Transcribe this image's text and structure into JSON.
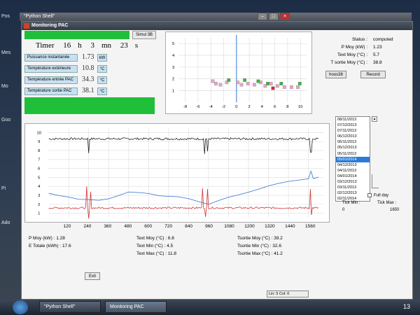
{
  "desktop": {
    "icons": [
      "Pos",
      "Mes",
      "Mo",
      "Goo",
      "Pi",
      "Ado"
    ],
    "shell_title": "\"Python Shell\""
  },
  "window": {
    "title": "Monitoring PAC",
    "simul_button": "Simul 3B"
  },
  "timer": {
    "label": "Timer",
    "h": "16",
    "h_unit": "h",
    "mn": "3",
    "mn_unit": "mn",
    "s": "23",
    "s_unit": "s"
  },
  "measurements": [
    {
      "label": "Puissance instantanée",
      "value": "1.73",
      "unit": "kW"
    },
    {
      "label": "Température extérieure",
      "value": "10.8",
      "unit": "°C"
    },
    {
      "label": "Température entrée PAC",
      "value": "34.3",
      "unit": "°C"
    },
    {
      "label": "Température sortie PAC",
      "value": "38.1",
      "unit": "°C"
    }
  ],
  "status": {
    "rows": [
      {
        "key": "Status :",
        "value": "computed"
      },
      {
        "key": "P Moy (kW) :",
        "value": "1.23"
      },
      {
        "key": "Text Moy (°C) :",
        "value": "5.7"
      },
      {
        "key": "T sortie Moy (°C) :",
        "value": "38.8"
      }
    ],
    "button_1": "hoos38",
    "button_2": "Record"
  },
  "date_list": {
    "items": [
      "08/11/2013",
      "07/12/2013",
      "07/11/2013",
      "06/12/2013",
      "06/11/2013",
      "05/12/2013",
      "05/11/2013",
      "05/01/2014",
      "04/12/2013",
      "04/11/2013",
      "04/01/2014",
      "03/12/2013",
      "03/11/2013",
      "02/12/2013",
      "02/11/2014"
    ],
    "selected_index": 7
  },
  "controls": {
    "full_day": "Full day",
    "tick_min_label": "Tick Min :",
    "tick_max_label": "Tick Max :",
    "tick_min_value": "0",
    "tick_max_value": "1650"
  },
  "stats": {
    "col1": [
      {
        "k": "P Moy (kW) :",
        "v": "1.28"
      },
      {
        "k": "E Totale (kWh) :",
        "v": "17.6"
      }
    ],
    "col2": [
      {
        "k": "Text Moy (°C) :",
        "v": "6.8"
      },
      {
        "k": "Text Min (°C) :",
        "v": "4.5"
      },
      {
        "k": "Text Max (°C) :",
        "v": "11.8"
      }
    ],
    "col3": [
      {
        "k": "Tsortie Moy (°C) :",
        "v": "39.2"
      },
      {
        "k": "Tsortie Min (°C) :",
        "v": "32.6"
      },
      {
        "k": "Tsortie Max (°C) :",
        "v": "41.2"
      }
    ]
  },
  "exit_label": "Exit",
  "statusbar_text": "Lin: 5 Col: 0",
  "taskbar": {
    "tasks": [
      "\"Python Shell\"",
      "Monitoring PAC"
    ],
    "clock": "13"
  },
  "chart_data": [
    {
      "type": "scatter",
      "x_ticks": [
        "-8",
        "-6",
        "-4",
        "-2",
        "0",
        "2",
        "4",
        "6",
        "8",
        "10"
      ],
      "y_ticks": [
        "1",
        "2",
        "3",
        "4",
        "5"
      ],
      "xlim": [
        -9,
        11
      ],
      "ylim": [
        0,
        5.5
      ],
      "series": [
        {
          "color": "#e3a6c6",
          "points": [
            [
              -3.7,
              1.8
            ],
            [
              -3.2,
              1.6
            ],
            [
              -2.5,
              1.5
            ],
            [
              -1.5,
              1.7
            ],
            [
              0.2,
              1.7
            ],
            [
              0.8,
              1.5
            ],
            [
              1.8,
              1.6
            ],
            [
              2.8,
              1.5
            ],
            [
              3.8,
              1.7
            ],
            [
              4.5,
              1.4
            ],
            [
              5.4,
              1.6
            ],
            [
              6.4,
              1.4
            ],
            [
              7.5,
              1.3
            ],
            [
              8.6,
              1.3
            ],
            [
              9.6,
              1.3
            ]
          ]
        },
        {
          "color": "#3db43a",
          "points": [
            [
              -1.2,
              1.9
            ],
            [
              1.3,
              1.9
            ],
            [
              3.4,
              1.8
            ],
            [
              4.9,
              1.6
            ],
            [
              7.0,
              1.6
            ],
            [
              9.9,
              1.6
            ]
          ]
        },
        {
          "color": "#d22b2b",
          "points": [
            [
              5.7,
              1.2
            ]
          ]
        }
      ]
    },
    {
      "type": "line",
      "x_ticks": [
        "120",
        "240",
        "360",
        "480",
        "600",
        "720",
        "840",
        "960",
        "1080",
        "1200",
        "1320",
        "1440",
        "1560"
      ],
      "y_ticks": [
        "1",
        "2",
        "3",
        "4",
        "5",
        "6",
        "7",
        "8",
        "9",
        "10"
      ],
      "xlim": [
        0,
        1650
      ],
      "ylim": [
        0.5,
        10.5
      ],
      "series": [
        {
          "color": "#222222",
          "base": 9.3,
          "noise": 0.12,
          "spikes": [
            [
              240,
              -1.6
            ],
            [
              935,
              -1.7
            ],
            [
              955,
              -1.4
            ],
            [
              1575,
              -1.5
            ]
          ]
        },
        {
          "color": "#2f6fd6",
          "kind": "blue",
          "points": [
            [
              0,
              3.2
            ],
            [
              60,
              3.0
            ],
            [
              120,
              2.8
            ],
            [
              180,
              2.6
            ],
            [
              240,
              2.5
            ],
            [
              300,
              2.4
            ],
            [
              360,
              2.6
            ],
            [
              420,
              3.0
            ],
            [
              480,
              3.4
            ],
            [
              540,
              3.3
            ],
            [
              600,
              3.2
            ],
            [
              660,
              3.0
            ],
            [
              720,
              2.9
            ],
            [
              780,
              2.8
            ],
            [
              840,
              2.6
            ],
            [
              900,
              2.3
            ],
            [
              960,
              2.0
            ],
            [
              1020,
              2.4
            ],
            [
              1080,
              2.8
            ],
            [
              1140,
              3.1
            ],
            [
              1200,
              3.4
            ],
            [
              1260,
              3.7
            ],
            [
              1320,
              4.0
            ],
            [
              1380,
              4.3
            ],
            [
              1440,
              4.5
            ],
            [
              1500,
              4.7
            ],
            [
              1560,
              4.8
            ],
            [
              1575,
              5.7
            ],
            [
              1590,
              4.9
            ],
            [
              1620,
              5.0
            ]
          ]
        },
        {
          "color": "#d33030",
          "base": 1.6,
          "noise": 0.1,
          "spikes": [
            [
              230,
              2.4
            ],
            [
              240,
              -1.2
            ],
            [
              250,
              1.8
            ],
            [
              925,
              2.2
            ],
            [
              940,
              -1.0
            ],
            [
              955,
              2.1
            ],
            [
              1570,
              2.1
            ],
            [
              1580,
              -0.8
            ]
          ]
        }
      ]
    }
  ]
}
